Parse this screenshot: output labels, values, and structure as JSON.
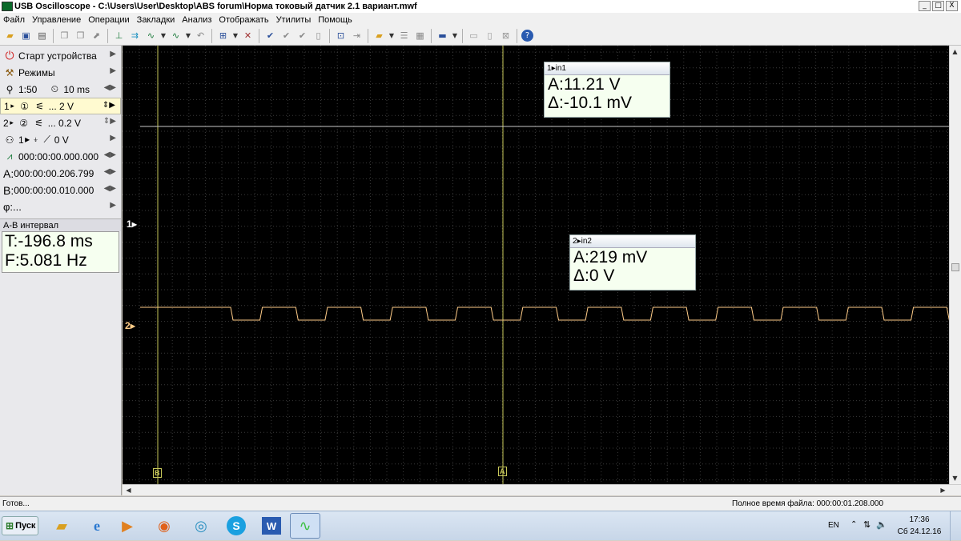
{
  "window": {
    "title": "USB Oscilloscope - C:\\Users\\User\\Desktop\\ABS forum\\Норма токовый датчик 2.1 вариант.mwf",
    "minimize": "_",
    "maximize": "□",
    "close": "X"
  },
  "menu": [
    "Файл",
    "Управление",
    "Операции",
    "Закладки",
    "Анализ",
    "Отображать",
    "Утилиты",
    "Помощь"
  ],
  "left_panel": {
    "start_device": "Старт устройства",
    "modes": "Режимы",
    "zoom": "1:50",
    "timebase": "10 ms",
    "channel1": {
      "number": "1",
      "value": "... 2 V"
    },
    "channel2": {
      "number": "2",
      "value": "... 0.2 V"
    },
    "trigger": {
      "channel": "1",
      "level": "0 V"
    },
    "trigger_time": "000:00:00.000.000",
    "cursor_a": {
      "label": "A:",
      "time": "000:00:00.206.799"
    },
    "cursor_b": {
      "label": "B:",
      "time": "000:00:00.010.000"
    },
    "phi": "φ:...",
    "ab_interval": {
      "title": "A-B интервал",
      "t": "T:-196.8 ms",
      "f": "F:5.081 Hz"
    }
  },
  "scope": {
    "background": "#000000",
    "grid_color": "#3a3a3a",
    "ch1_color": "#c8c8c8",
    "ch2_color": "#ffcc88",
    "cursor_color": "#c8c85a",
    "ch1_marker": "1",
    "ch2_marker": "2",
    "ch1_level_v": 11.21,
    "ch2_pulse_period_ms": 14.2,
    "ch2_pulse_duty": 0.45,
    "cursor_b_label": "B",
    "cursor_a_label": "A",
    "readout1": {
      "header": "in1",
      "channel": "1",
      "a": "A:11.21 V",
      "delta": "Δ:-10.1 mV"
    },
    "readout2": {
      "header": "in2",
      "channel": "2",
      "a": "A:219 mV",
      "delta": "Δ:0 V"
    }
  },
  "status": {
    "left": "Готов...",
    "right": "Полное время файла: 000:00:01.208.000"
  },
  "taskbar": {
    "start": "Пуск",
    "lang": "EN",
    "time": "17:36",
    "date": "Сб 24.12.16",
    "apps": [
      "file-explorer",
      "internet-explorer",
      "media-player",
      "firefox",
      "chrome",
      "skype",
      "word",
      "oscilloscope"
    ]
  }
}
